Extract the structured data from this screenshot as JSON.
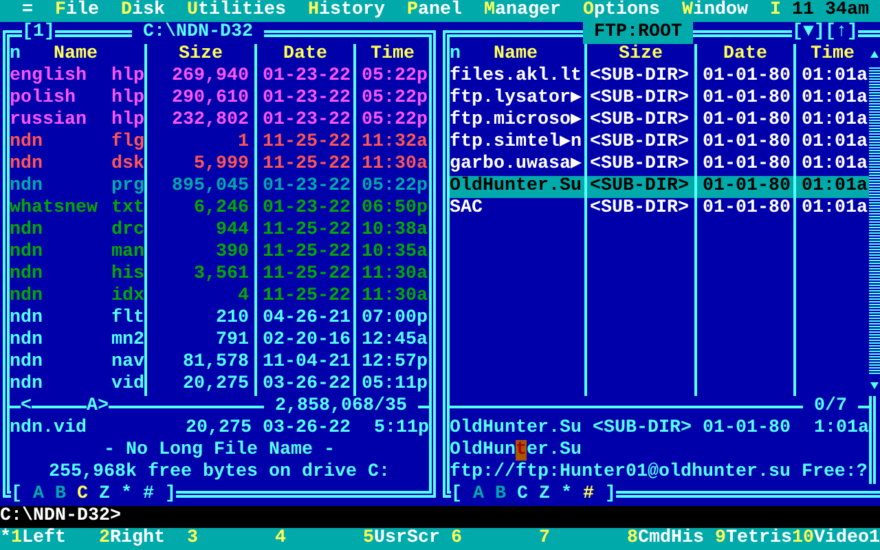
{
  "menu_bar": {
    "items": [
      {
        "label": "=",
        "hotkey": false
      },
      {
        "label": "File",
        "hotkey": true
      },
      {
        "label": "Disk",
        "hotkey": true
      },
      {
        "label": "Utilities",
        "hotkey": true
      },
      {
        "label": "History",
        "hotkey": true
      },
      {
        "label": "Panel",
        "hotkey": true
      },
      {
        "label": "Manager",
        "hotkey": true
      },
      {
        "label": "Options",
        "hotkey": true
      },
      {
        "label": "Window",
        "hotkey": true
      },
      {
        "label": "I",
        "hotkey": true
      }
    ],
    "clock": "11 34am"
  },
  "panels": [
    {
      "active": false,
      "number": "[1]",
      "title": "C:\\NDN-D32",
      "column_lead": "n",
      "columns": [
        "Name",
        "Size",
        "Date",
        "Time"
      ],
      "files": [
        {
          "name": "english",
          "ext": "hlp",
          "size": "269,940",
          "date": "01-23-22",
          "time": "05:22p",
          "color": "#ff55ff",
          "selected": false
        },
        {
          "name": "polish",
          "ext": "hlp",
          "size": "290,610",
          "date": "01-23-22",
          "time": "05:22p",
          "color": "#ff55ff",
          "selected": false
        },
        {
          "name": "russian",
          "ext": "hlp",
          "size": "232,802",
          "date": "01-23-22",
          "time": "05:22p",
          "color": "#ff55ff",
          "selected": false
        },
        {
          "name": "ndn",
          "ext": "flg",
          "size": "1",
          "date": "11-25-22",
          "time": "11:32a",
          "color": "#ff5555",
          "selected": false
        },
        {
          "name": "ndn",
          "ext": "dsk",
          "size": "5,999",
          "date": "11-25-22",
          "time": "11:30a",
          "color": "#ff5555",
          "selected": false
        },
        {
          "name": "ndn",
          "ext": "prg",
          "size": "895,045",
          "date": "01-23-22",
          "time": "05:22p",
          "color": "#00aaaa",
          "selected": false
        },
        {
          "name": "whatsnew",
          "ext": "txt",
          "size": "6,246",
          "date": "01-23-22",
          "time": "06:50p",
          "color": "#00aa00",
          "selected": false
        },
        {
          "name": "ndn",
          "ext": "drc",
          "size": "944",
          "date": "11-25-22",
          "time": "10:38a",
          "color": "#00aa00",
          "selected": false
        },
        {
          "name": "ndn",
          "ext": "man",
          "size": "390",
          "date": "11-25-22",
          "time": "10:35a",
          "color": "#00aa00",
          "selected": false
        },
        {
          "name": "ndn",
          "ext": "his",
          "size": "3,561",
          "date": "11-25-22",
          "time": "11:30a",
          "color": "#00aa00",
          "selected": false
        },
        {
          "name": "ndn",
          "ext": "idx",
          "size": "4",
          "date": "11-25-22",
          "time": "11:30a",
          "color": "#00aa00",
          "selected": false
        },
        {
          "name": "ndn",
          "ext": "flt",
          "size": "210",
          "date": "04-26-21",
          "time": "07:00p",
          "color": "#55ffff",
          "selected": false
        },
        {
          "name": "ndn",
          "ext": "mn2",
          "size": "791",
          "date": "02-20-16",
          "time": "12:45a",
          "color": "#55ffff",
          "selected": false
        },
        {
          "name": "ndn",
          "ext": "nav",
          "size": "81,578",
          "date": "11-04-21",
          "time": "12:57p",
          "color": "#55ffff",
          "selected": false
        },
        {
          "name": "ndn",
          "ext": "vid",
          "size": "20,275",
          "date": "03-26-22",
          "time": "05:11p",
          "color": "#55ffff",
          "selected": false
        }
      ],
      "sort_marks": [
        "<",
        "A>"
      ],
      "summary": "2,858,068/35",
      "info": {
        "name": "ndn.vid",
        "size": "20,275",
        "date": "03-26-22",
        "time": "5:11p"
      },
      "long_name": "- No Long File Name -",
      "free_space": "255,968k free bytes on drive C:",
      "drive_bar": {
        "open": "[",
        "close": "]",
        "drives": [
          {
            "label": "A",
            "dim": true,
            "selected": false
          },
          {
            "label": "B",
            "dim": true,
            "selected": false
          },
          {
            "label": "C",
            "dim": false,
            "selected": true
          },
          {
            "label": "Z",
            "dim": false,
            "selected": false
          },
          {
            "label": "*",
            "dim": false,
            "selected": false
          },
          {
            "label": "#",
            "dim": false,
            "selected": false
          }
        ]
      }
    },
    {
      "active": true,
      "title": "FTP:ROOT",
      "buttons": [
        "[▼]",
        "[↑]"
      ],
      "column_lead": "n",
      "columns": [
        "Name",
        "Size",
        "Date",
        "Time"
      ],
      "files": [
        {
          "name": "files.akl.lt",
          "size": "<SUB-DIR>",
          "date": "01-01-80",
          "time": "01:01a",
          "selected": false
        },
        {
          "name": "ftp.lysator▶",
          "size": "<SUB-DIR>",
          "date": "01-01-80",
          "time": "01:01a",
          "selected": false
        },
        {
          "name": "ftp.microso▶",
          "size": "<SUB-DIR>",
          "date": "01-01-80",
          "time": "01:01a",
          "selected": false
        },
        {
          "name": "ftp.simtel▶n",
          "size": "<SUB-DIR>",
          "date": "01-01-80",
          "time": "01:01a",
          "selected": false
        },
        {
          "name": "garbo.uwasa▶",
          "size": "<SUB-DIR>",
          "date": "01-01-80",
          "time": "01:01a",
          "selected": false
        },
        {
          "name": "OldHunter.Su",
          "size": "<SUB-DIR>",
          "date": "01-01-80",
          "time": "01:01a",
          "selected": true
        },
        {
          "name": "SAC",
          "size": "<SUB-DIR>",
          "date": "01-01-80",
          "time": "01:01a",
          "selected": false
        }
      ],
      "summary": "0/7",
      "info": {
        "name": "OldHunter.Su",
        "size": "<SUB-DIR>",
        "date": "01-01-80",
        "time": "1:01a"
      },
      "name_edit": {
        "before_cursor": "OldHun",
        "at_cursor": "t",
        "after_cursor": "er.Su"
      },
      "ftp_address": "ftp://ftp:Hunter01@oldhunter.su Free:?",
      "drive_bar": {
        "open": "[",
        "close": "]",
        "drives": [
          {
            "label": "A",
            "dim": true,
            "selected": false
          },
          {
            "label": "B",
            "dim": true,
            "selected": false
          },
          {
            "label": "C",
            "dim": false,
            "selected": false
          },
          {
            "label": "Z",
            "dim": false,
            "selected": false
          },
          {
            "label": "*",
            "dim": false,
            "selected": false
          },
          {
            "label": "#",
            "dim": false,
            "selected": true
          }
        ]
      }
    }
  ],
  "command_line": "C:\\NDN-D32>",
  "key_bar": {
    "lead": "*",
    "keys": [
      {
        "key": "1",
        "label": "Left"
      },
      {
        "key": "2",
        "label": "Right"
      },
      {
        "key": "3"
      },
      {
        "key": "4"
      },
      {
        "key": "5",
        "label": "UsrScr"
      },
      {
        "key": "6"
      },
      {
        "key": "7"
      },
      {
        "key": "8",
        "label": "CmdHis"
      },
      {
        "key": "9",
        "label": "Tetris"
      },
      {
        "key": "10",
        "label": "Video1"
      }
    ]
  }
}
